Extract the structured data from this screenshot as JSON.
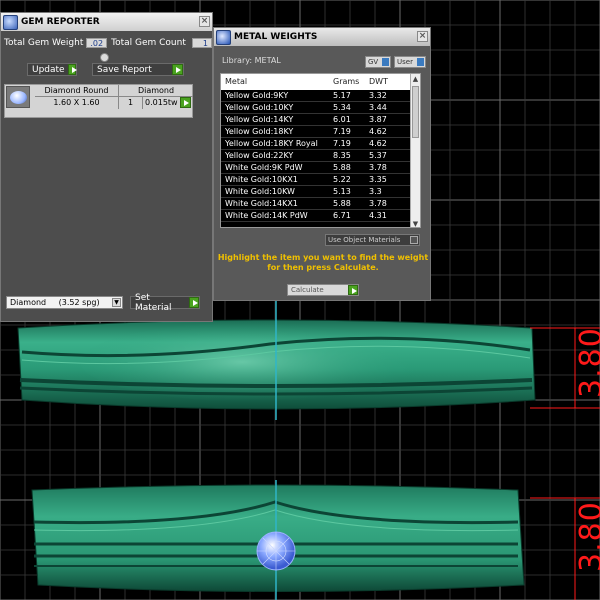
{
  "colors": {
    "grid": "#3a3a3a",
    "grid_major": "#6a6a6a",
    "model": "#2e9f7a",
    "model_dark": "#0f4d3a",
    "dimension": "#ff1a1a",
    "hint": "#f0c000",
    "accent_green": "#4aa31f"
  },
  "gem_reporter": {
    "title": "GEM REPORTER",
    "icon": "gem-reporter-icon",
    "total_weight_label": "Total Gem Weight",
    "total_weight_value": ".02",
    "total_count_label": "Total Gem Count",
    "total_count_value": "1",
    "update_label": "Update",
    "save_report_label": "Save Report",
    "table": {
      "columns": [
        "Diamond Round",
        "Diamond"
      ],
      "row": {
        "size": "1.60 X 1.60",
        "count": "1",
        "weight": "0.015tw"
      }
    },
    "material_value": "Diamond",
    "material_spg": "(3.52 spg)",
    "set_material_label": "Set Material"
  },
  "metal_weights": {
    "title": "METAL WEIGHTS",
    "icon": "metal-weights-icon",
    "library_label": "Library: METAL",
    "gv_label": "GV",
    "user_label": "User",
    "columns": [
      "Metal",
      "Grams",
      "DWT"
    ],
    "rows": [
      {
        "metal": "Yellow Gold:9KY",
        "grams": "5.17",
        "dwt": "3.32"
      },
      {
        "metal": "Yellow Gold:10KY",
        "grams": "5.34",
        "dwt": "3.44"
      },
      {
        "metal": "Yellow Gold:14KY",
        "grams": "6.01",
        "dwt": "3.87"
      },
      {
        "metal": "Yellow Gold:18KY",
        "grams": "7.19",
        "dwt": "4.62"
      },
      {
        "metal": "Yellow Gold:18KY Royal",
        "grams": "7.19",
        "dwt": "4.62"
      },
      {
        "metal": "Yellow Gold:22KY",
        "grams": "8.35",
        "dwt": "5.37"
      },
      {
        "metal": "White Gold:9K PdW",
        "grams": "5.88",
        "dwt": "3.78"
      },
      {
        "metal": "White Gold:10KX1",
        "grams": "5.22",
        "dwt": "3.35"
      },
      {
        "metal": "White Gold:10KW",
        "grams": "5.13",
        "dwt": "3.3"
      },
      {
        "metal": "White Gold:14KX1",
        "grams": "5.88",
        "dwt": "3.78"
      },
      {
        "metal": "White Gold:14K PdW",
        "grams": "6.71",
        "dwt": "4.31"
      }
    ],
    "use_object_materials_label": "Use Object Materials",
    "hint_line1": "Highlight the item you want to find the weight",
    "hint_line2": "for then press Calculate.",
    "calculate_label": "Calculate"
  },
  "viewport": {
    "dimension_top": "3.80",
    "dimension_bottom": "3.80"
  }
}
